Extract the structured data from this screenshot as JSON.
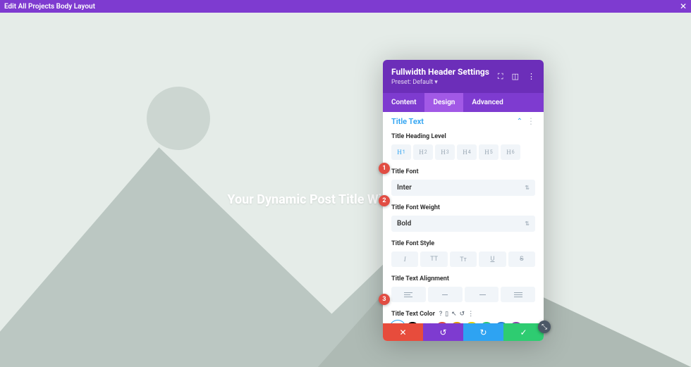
{
  "topbar": {
    "title": "Edit All Projects Body Layout"
  },
  "hero": {
    "title": "Your Dynamic Post Title Will Display Here"
  },
  "panel": {
    "title": "Fullwidth Header Settings",
    "preset": "Preset: Default",
    "tabs": {
      "content": "Content",
      "design": "Design",
      "advanced": "Advanced",
      "active": "design"
    },
    "section": {
      "title": "Title Text"
    },
    "heading_level": {
      "label": "Title Heading Level",
      "options": [
        "H₁",
        "H₂",
        "H₃",
        "H₄",
        "H₅",
        "H₆"
      ],
      "active": 0
    },
    "font": {
      "label": "Title Font",
      "value": "Inter"
    },
    "weight": {
      "label": "Title Font Weight",
      "value": "Bold"
    },
    "style": {
      "label": "Title Font Style"
    },
    "align": {
      "label": "Title Text Alignment"
    },
    "color": {
      "label": "Title Text Color"
    },
    "swatches": [
      "#ffffff",
      "#000000",
      "#ffffff",
      "#e74c3c",
      "#e6a100",
      "#f1c40f",
      "#2ecc71",
      "#2980d9",
      "#8e44ad"
    ]
  },
  "badges": {
    "b1": "1",
    "b2": "2",
    "b3": "3"
  }
}
